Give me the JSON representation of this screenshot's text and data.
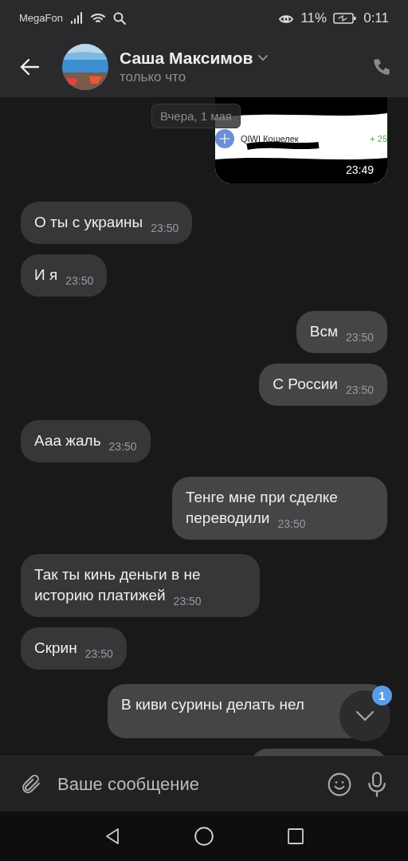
{
  "status_bar": {
    "carrier": "MegaFon",
    "battery": "11%",
    "time": "0:11"
  },
  "header": {
    "name": "Саша Максимов",
    "status": "только что"
  },
  "date_label": "Вчера, 1 мая",
  "attachment": {
    "outgoing": true,
    "title": "QIWI Кошелек",
    "amount": "+ 25",
    "time": "23:49"
  },
  "messages": [
    {
      "outgoing": false,
      "kind": "text",
      "text": "О ты с украины",
      "time": "23:50"
    },
    {
      "outgoing": false,
      "kind": "text",
      "text": "И я",
      "time": "23:50"
    },
    {
      "outgoing": true,
      "kind": "text",
      "text": "Всм",
      "time": "23:50"
    },
    {
      "outgoing": true,
      "kind": "text",
      "text": "С России",
      "time": "23:50"
    },
    {
      "outgoing": false,
      "kind": "text",
      "text": "Ааа жаль",
      "time": "23:50"
    },
    {
      "outgoing": true,
      "kind": "text",
      "text": "Тенге мне при сделке переводили",
      "time": "23:50"
    },
    {
      "outgoing": false,
      "kind": "text",
      "text": "Так ты кинь деньги в не историю платижей",
      "time": "23:50"
    },
    {
      "outgoing": false,
      "kind": "text",
      "text": "Скрин",
      "time": "23:50"
    },
    {
      "outgoing": true,
      "kind": "covered",
      "text": "В киви сурины делать нел"
    },
    {
      "outgoing": true,
      "kind": "clipped"
    }
  ],
  "scroll_badge": "1",
  "composer": {
    "placeholder": "Ваше сообщение"
  }
}
